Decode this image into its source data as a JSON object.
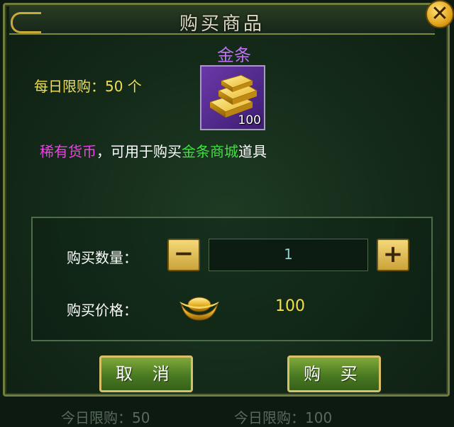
{
  "dialog": {
    "title": "购买商品",
    "close_icon": "close-x-icon"
  },
  "item": {
    "name": "金条",
    "daily_limit": "每日限购：50 个",
    "icon": "gold-bars-icon",
    "count": "100",
    "description": {
      "part1": "稀有货币",
      "part2": "，可用于购买",
      "part3": "金条商城",
      "part4": "道具"
    }
  },
  "purchase": {
    "quantity_label": "购买数量：",
    "quantity_value": "1",
    "decrement_label": "−",
    "increment_label": "+",
    "price_label": "购买价格：",
    "price_icon": "gold-ingot-icon",
    "price_value": "100"
  },
  "buttons": {
    "cancel": "取 消",
    "buy": "购 买"
  },
  "backdrop": {
    "left": "今日限购：50",
    "right": "今日限购：100"
  },
  "colors": {
    "item_name": "#bb73f2",
    "daily_limit": "#eedd5a",
    "rare_text": "#f040e8",
    "shop_text": "#3fe03f",
    "price": "#f4df4c"
  }
}
